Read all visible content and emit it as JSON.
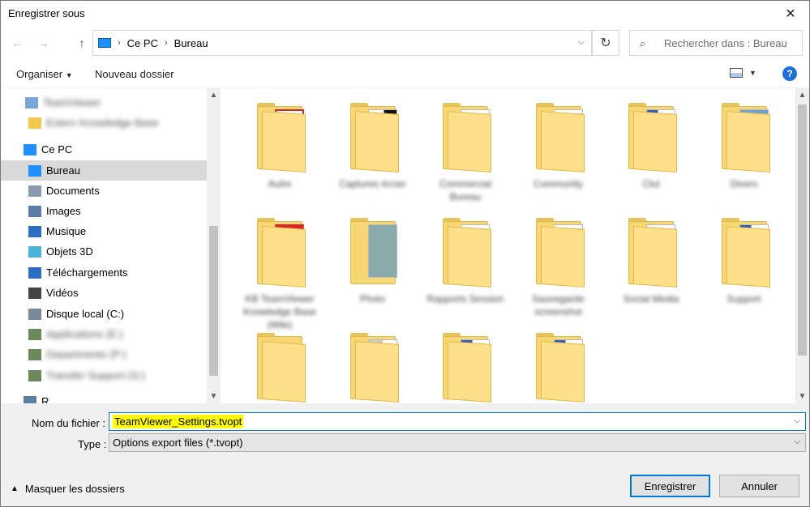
{
  "window": {
    "title": "Enregistrer sous"
  },
  "nav": {
    "breadcrumb": [
      "Ce PC",
      "Bureau"
    ],
    "search_placeholder": "Rechercher dans : Bureau"
  },
  "toolbar": {
    "organize": "Organiser",
    "new_folder": "Nouveau dossier",
    "help": "?"
  },
  "sidebar": {
    "items": [
      {
        "label": "TeamViewer",
        "icon": "cloud-icon",
        "blurred": true
      },
      {
        "label": "Extern Knowledge Base",
        "icon": "folder-icon",
        "blurred": true
      },
      {
        "label": "Ce PC",
        "icon": "computer-icon",
        "blurred": false
      },
      {
        "label": "Bureau",
        "icon": "desktop-icon",
        "blurred": false,
        "selected": true
      },
      {
        "label": "Documents",
        "icon": "documents-icon",
        "blurred": false
      },
      {
        "label": "Images",
        "icon": "images-icon",
        "blurred": false
      },
      {
        "label": "Musique",
        "icon": "music-icon",
        "blurred": false
      },
      {
        "label": "Objets 3D",
        "icon": "objects3d-icon",
        "blurred": false
      },
      {
        "label": "Téléchargements",
        "icon": "downloads-icon",
        "blurred": false
      },
      {
        "label": "Vidéos",
        "icon": "videos-icon",
        "blurred": false
      },
      {
        "label": "Disque local (C:)",
        "icon": "drive-icon",
        "blurred": false
      },
      {
        "label": "Applications (E:)",
        "icon": "network-drive-icon",
        "blurred": true
      },
      {
        "label": "Departments (P:)",
        "icon": "network-drive-icon",
        "blurred": true
      },
      {
        "label": "Transfer Support (S:)",
        "icon": "network-drive-icon",
        "blurred": true
      },
      {
        "label": "R...",
        "icon": "network-icon",
        "blurred": false
      }
    ]
  },
  "files": [
    {
      "name": "Autre",
      "doc": "teamviewer"
    },
    {
      "name": "Captures écran",
      "doc": "screens"
    },
    {
      "name": "Commercial Bureau",
      "doc": "doc"
    },
    {
      "name": "Community",
      "doc": "text"
    },
    {
      "name": "Clut",
      "doc": "word"
    },
    {
      "name": "Divers",
      "doc": "photo"
    },
    {
      "name": "KB TeamViewer Knowledge Base (Wiki)",
      "doc": "pdf"
    },
    {
      "name": "Photo",
      "doc": "photo-only"
    },
    {
      "name": "Rapports Session",
      "doc": "doc"
    },
    {
      "name": "Sauvegarde screenshot",
      "doc": "text"
    },
    {
      "name": "Social Media",
      "doc": "blank"
    },
    {
      "name": "Support",
      "doc": "word"
    },
    {
      "name": "",
      "doc": "none"
    },
    {
      "name": "",
      "doc": "cat"
    },
    {
      "name": "",
      "doc": "word"
    },
    {
      "name": "",
      "doc": "word"
    }
  ],
  "form": {
    "filename_label": "Nom du fichier :",
    "filename_value": "TeamViewer_Settings.tvopt",
    "type_label": "Type :",
    "type_value": "Options export files (*.tvopt)"
  },
  "footer": {
    "hide_folders": "Masquer les dossiers",
    "save": "Enregistrer",
    "cancel": "Annuler"
  },
  "colors": {
    "accent": "#0078d7",
    "highlight": "#ffff00",
    "selected": "#d9d9d9"
  }
}
